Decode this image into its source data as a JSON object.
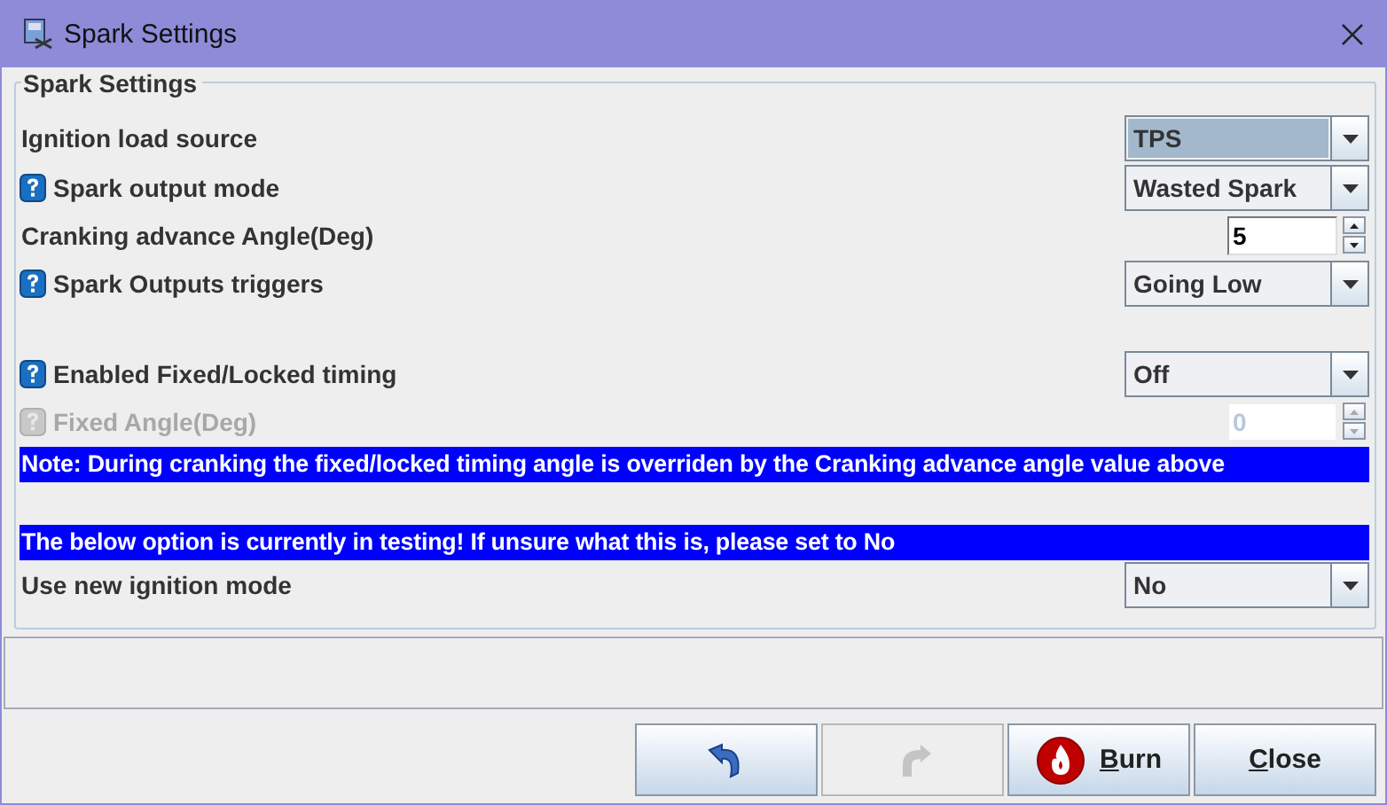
{
  "window": {
    "title": "Spark Settings"
  },
  "group": {
    "title": "Spark Settings"
  },
  "rows": [
    {
      "kind": "dropdown",
      "label": "Ignition load source",
      "help": false,
      "disabled": false,
      "value": "TPS",
      "focused": true
    },
    {
      "kind": "dropdown",
      "label": "Spark output mode",
      "help": true,
      "disabled": false,
      "value": "Wasted Spark",
      "focused": false
    },
    {
      "kind": "spinner",
      "label": "Cranking advance Angle(Deg)",
      "help": false,
      "disabled": false,
      "value": "5"
    },
    {
      "kind": "dropdown",
      "label": "Spark Outputs triggers",
      "help": true,
      "disabled": false,
      "value": "Going Low",
      "focused": false
    },
    {
      "kind": "blank"
    },
    {
      "kind": "dropdown",
      "label": "Enabled Fixed/Locked timing",
      "help": true,
      "disabled": false,
      "value": "Off",
      "focused": false
    },
    {
      "kind": "spinner",
      "label": "Fixed Angle(Deg)",
      "help": true,
      "disabled": true,
      "value": "0"
    },
    {
      "kind": "note",
      "text": "Note: During cranking the fixed/locked timing angle is overriden by the Cranking advance angle value above"
    },
    {
      "kind": "blank"
    },
    {
      "kind": "note",
      "text": "The below option is currently in testing! If unsure what this is, please set to No"
    },
    {
      "kind": "dropdown",
      "label": "Use new ignition mode",
      "help": false,
      "disabled": false,
      "value": "No",
      "focused": false
    }
  ],
  "buttons": [
    {
      "kind": "undo",
      "disabled": false
    },
    {
      "kind": "redo",
      "disabled": true
    },
    {
      "kind": "burn",
      "label": "Burn",
      "disabled": false,
      "underline_first": true
    },
    {
      "kind": "close",
      "label": "Close",
      "disabled": false,
      "underline_first": true
    }
  ]
}
